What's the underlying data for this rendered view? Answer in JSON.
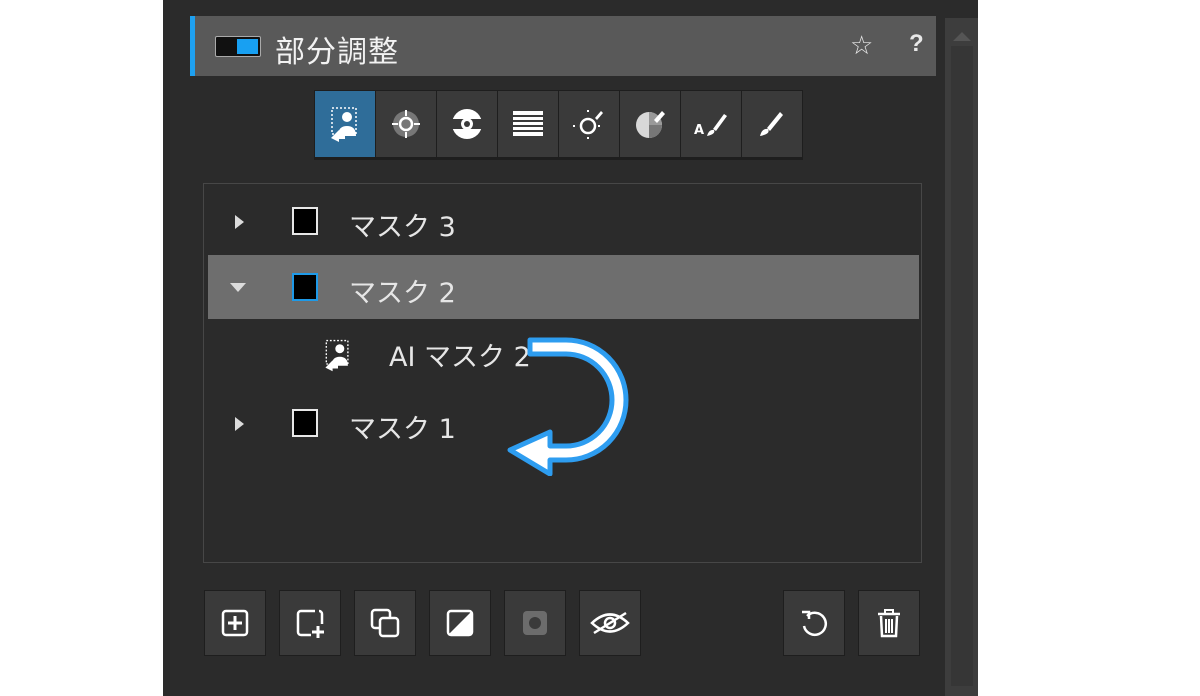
{
  "panel": {
    "title": "部分調整",
    "accent_color": "#1ea0f0",
    "header_icons": {
      "favorite": "star-icon",
      "help": "help-icon"
    },
    "star_glyph": "☆",
    "help_glyph": "?"
  },
  "toolbar": {
    "tools": [
      {
        "id": "ai-mask",
        "icon": "ai-person-mask-icon",
        "active": true
      },
      {
        "id": "control-point",
        "icon": "control-point-icon",
        "active": false
      },
      {
        "id": "radial-gradient",
        "icon": "radial-gradient-icon",
        "active": false
      },
      {
        "id": "linear-gradient",
        "icon": "linear-gradient-icon",
        "active": false
      },
      {
        "id": "luminance-range",
        "icon": "luminance-range-icon",
        "active": false
      },
      {
        "id": "color-range",
        "icon": "color-range-icon",
        "active": false
      },
      {
        "id": "auto-brush",
        "icon": "auto-brush-icon",
        "active": false
      },
      {
        "id": "brush",
        "icon": "brush-icon",
        "active": false
      }
    ]
  },
  "mask_list": {
    "items": [
      {
        "label": "マスク 3",
        "expanded": false,
        "selected": false
      },
      {
        "label": "マスク 2",
        "expanded": true,
        "selected": true,
        "children": [
          {
            "label": "AI マスク 2",
            "icon": "ai-person-mask-icon"
          }
        ]
      },
      {
        "label": "マスク 1",
        "expanded": false,
        "selected": false
      }
    ]
  },
  "annotation": {
    "icon": "curved-return-arrow-icon",
    "color": "#2e9df0"
  },
  "bottom_buttons": [
    {
      "id": "add-mask",
      "icon": "plus-square-icon",
      "enabled": true
    },
    {
      "id": "add-submask",
      "icon": "add-layer-icon",
      "enabled": true
    },
    {
      "id": "duplicate",
      "icon": "duplicate-icon",
      "enabled": true
    },
    {
      "id": "invert",
      "icon": "invert-icon",
      "enabled": true
    },
    {
      "id": "mask-overlay",
      "icon": "overlay-icon",
      "enabled": false
    },
    {
      "id": "toggle-visibility",
      "icon": "eye-hidden-icon",
      "enabled": true
    },
    {
      "id": "reset",
      "icon": "reset-icon",
      "enabled": true
    },
    {
      "id": "delete",
      "icon": "trash-icon",
      "enabled": true
    }
  ]
}
